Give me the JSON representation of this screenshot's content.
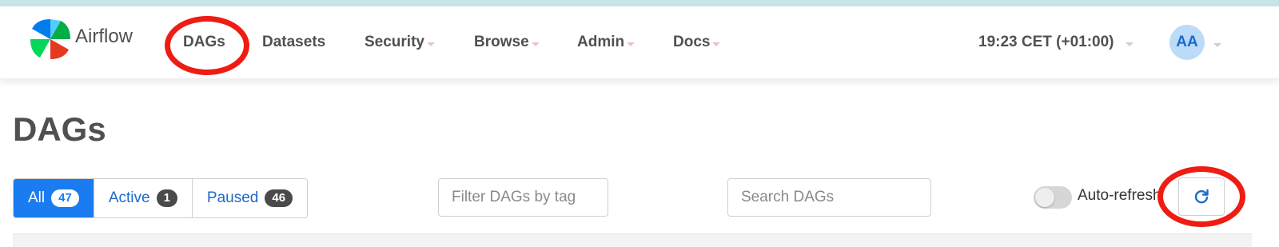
{
  "app": {
    "name": "Airflow"
  },
  "nav": {
    "items": [
      {
        "label": "DAGs",
        "dropdown": false
      },
      {
        "label": "Datasets",
        "dropdown": false
      },
      {
        "label": "Security",
        "dropdown": true
      },
      {
        "label": "Browse",
        "dropdown": true
      },
      {
        "label": "Admin",
        "dropdown": true
      },
      {
        "label": "Docs",
        "dropdown": true
      }
    ],
    "time": "19:23 CET (+01:00)",
    "user_initials": "AA"
  },
  "page": {
    "title": "DAGs",
    "filters": [
      {
        "label": "All",
        "count": "47",
        "active": true
      },
      {
        "label": "Active",
        "count": "1",
        "active": false
      },
      {
        "label": "Paused",
        "count": "46",
        "active": false
      }
    ],
    "tag_filter": {
      "placeholder": "Filter DAGs by tag",
      "value": ""
    },
    "search": {
      "placeholder": "Search DAGs",
      "value": ""
    },
    "auto_refresh": {
      "label": "Auto-refresh",
      "enabled": false
    },
    "refresh_icon": "refresh-icon"
  },
  "annotations": {
    "color": "#ee1c12",
    "highlighted": [
      "DAGs nav link",
      "refresh button"
    ]
  },
  "colors": {
    "accent": "#1a7cf0",
    "avatar_bg": "#bcdbf7",
    "top_strip": "#c7e4e7"
  }
}
